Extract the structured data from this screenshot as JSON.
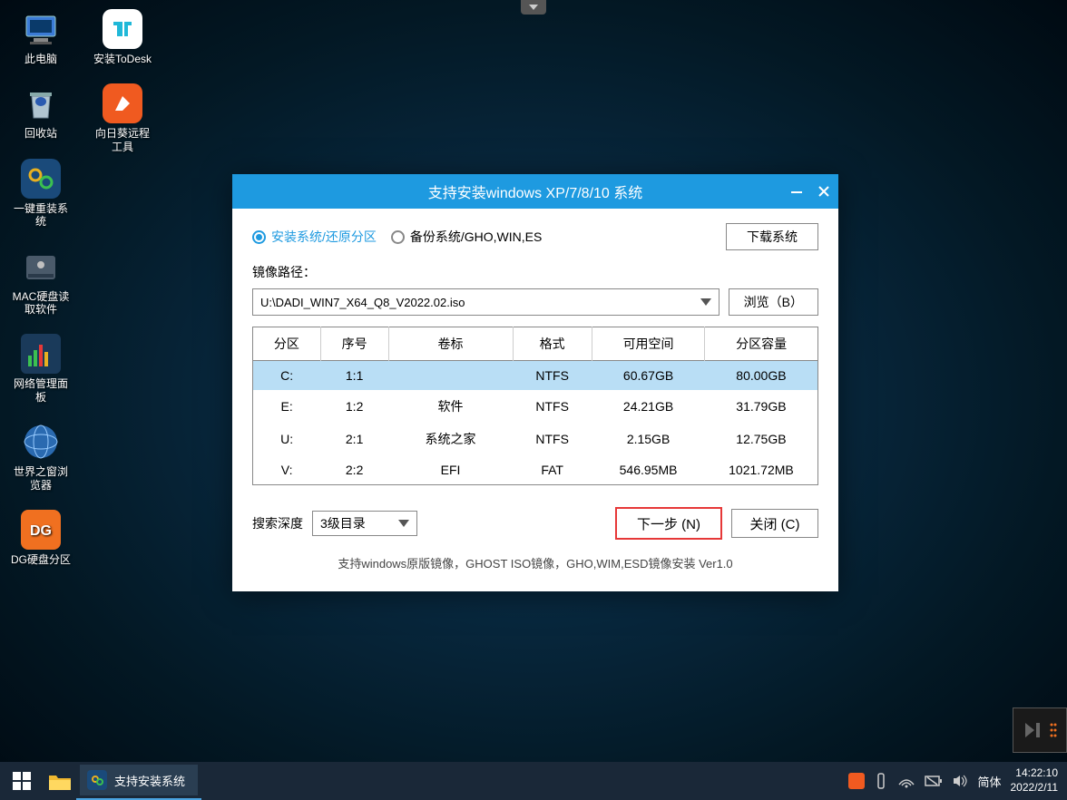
{
  "desktop_icons": {
    "this_pc": "此电脑",
    "todesk": "安装ToDesk",
    "recycle": "回收站",
    "sunflower": "向日葵远程工具",
    "onekey": "一键重装系统",
    "mac_disk": "MAC硬盘读取软件",
    "netmgr": "网络管理面板",
    "browser": "世界之窗浏览器",
    "dg": "DG硬盘分区"
  },
  "window": {
    "title": "支持安装windows XP/7/8/10 系统",
    "radio_install": "安装系统/还原分区",
    "radio_backup": "备份系统/GHO,WIN,ES",
    "download_btn": "下载系统",
    "path_label": "镜像路径：",
    "path_value": "U:\\DADI_WIN7_X64_Q8_V2022.02.iso",
    "browse_btn": "浏览（B）",
    "headers": {
      "partition": "分区",
      "index": "序号",
      "label": "卷标",
      "format": "格式",
      "free": "可用空间",
      "capacity": "分区容量"
    },
    "rows": [
      {
        "partition": "C:",
        "index": "1:1",
        "label": "",
        "format": "NTFS",
        "free": "60.67GB",
        "capacity": "80.00GB"
      },
      {
        "partition": "E:",
        "index": "1:2",
        "label": "软件",
        "format": "NTFS",
        "free": "24.21GB",
        "capacity": "31.79GB"
      },
      {
        "partition": "U:",
        "index": "2:1",
        "label": "系统之家",
        "format": "NTFS",
        "free": "2.15GB",
        "capacity": "12.75GB"
      },
      {
        "partition": "V:",
        "index": "2:2",
        "label": "EFI",
        "format": "FAT",
        "free": "546.95MB",
        "capacity": "1021.72MB"
      }
    ],
    "search_depth_label": "搜索深度",
    "search_depth_value": "3级目录",
    "next_btn": "下一步 (N)",
    "close_btn": "关闭 (C)",
    "footer": "支持windows原版镜像，GHOST ISO镜像，GHO,WIM,ESD镜像安装 Ver1.0"
  },
  "taskbar": {
    "app_title": "支持安装系统",
    "ime": "简体",
    "time": "14:22:10",
    "date": "2022/2/11"
  }
}
